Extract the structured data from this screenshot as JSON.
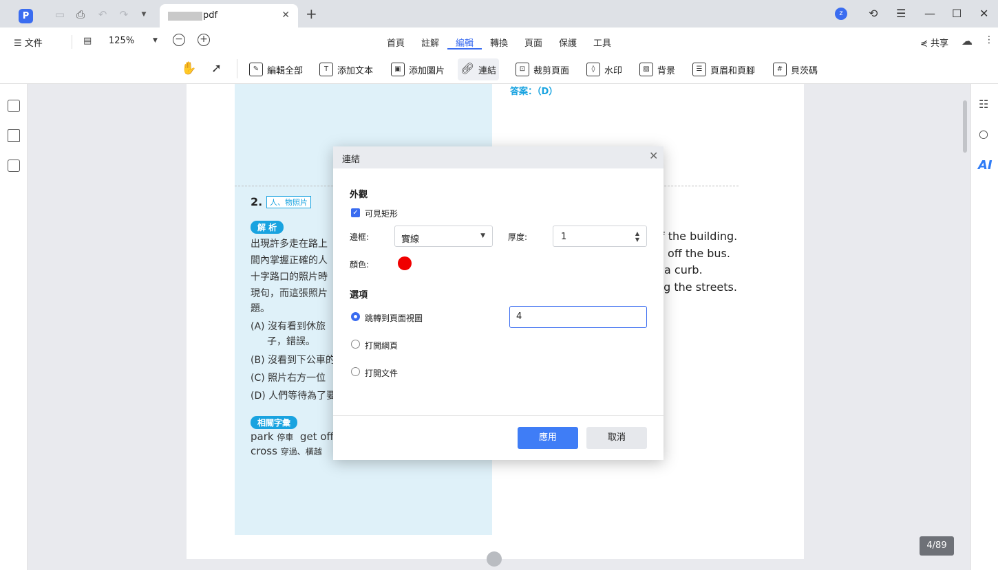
{
  "titlebar": {
    "tab_title": "pdf",
    "user_initial": "z"
  },
  "menubar": {
    "file_label": "文件",
    "zoom": "125%",
    "tabs": [
      "首頁",
      "註解",
      "編輯",
      "轉換",
      "頁面",
      "保護",
      "工具"
    ],
    "active_tab": "編輯",
    "share_label": "共享"
  },
  "toolbar": {
    "tools": [
      "編輯全部",
      "添加文本",
      "添加圖片",
      "連結",
      "裁剪頁面",
      "水印",
      "背景",
      "頁眉和頁腳",
      "貝茨碼"
    ],
    "active_tool": "連結"
  },
  "sidebar_right": {
    "ai_label": "AI"
  },
  "document": {
    "answer": "答案：（D）",
    "question_number": "2.",
    "question_tag": "人、物照片",
    "analysis_pill": "解 析",
    "analysis_lines": [
      "出現許多走在路上",
      "間內掌握正確的人",
      "十字路口的照片時",
      "現句，而這張照片",
      "題。"
    ],
    "option_a_1": "(A) 沒有看到休旅",
    "option_a_2": "子，錯誤。",
    "option_b": "(B) 沒看到下公車的",
    "option_c": "(C) 照片右方一位",
    "option_d": "(D) 人們等待為了要",
    "vocab_pill": "相關字彙",
    "vocab_1_word": "park",
    "vocab_1_meaning": "停車",
    "vocab_1_word2": "get off",
    "vocab_2_word": "cross",
    "vocab_2_meaning": "穿過、橫越",
    "eng_lines": [
      "f the building.",
      "off the bus.",
      "a curb.",
      "ng the streets."
    ]
  },
  "page_indicator": "4/89",
  "dialog": {
    "title": "連結",
    "appearance_heading": "外觀",
    "visible_rect_label": "可見矩形",
    "visible_rect_checked": true,
    "border_label": "邊框:",
    "border_value": "實線",
    "thickness_label": "厚度:",
    "thickness_value": "1",
    "color_label": "顏色:",
    "color_value": "#f00000",
    "options_heading": "選項",
    "option_goto": "跳轉到頁面視圖",
    "option_web": "打開網頁",
    "option_file": "打開文件",
    "selected_option": "跳轉到頁面視圖",
    "page_value": "4",
    "apply_label": "應用",
    "cancel_label": "取消"
  }
}
